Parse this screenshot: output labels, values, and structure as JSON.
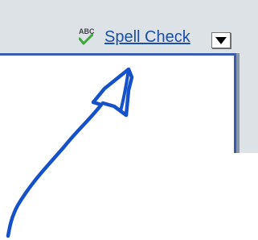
{
  "toolbar": {
    "spell_check": {
      "icon_text": "ABC",
      "icon": "spell-check-icon",
      "label": "Spell Check"
    },
    "dropdown": {
      "icon": "triangle-down-icon"
    }
  },
  "annotation": {
    "shape": "freehand-arrow",
    "color": "#1552c9"
  },
  "colors": {
    "toolbar_background": "#dde2e7",
    "frame_border": "#3a5cae",
    "link": "#1a4fa3",
    "checkmark": "#3fa63a"
  }
}
